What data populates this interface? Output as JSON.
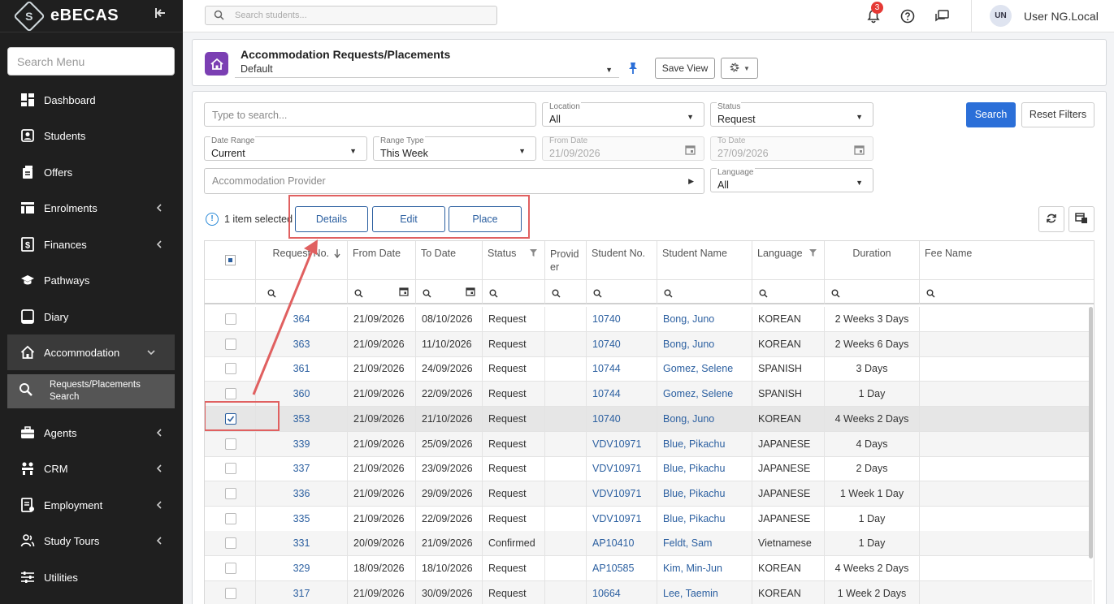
{
  "brand": {
    "name": "eBECAS",
    "logo_letter": "S"
  },
  "sidebar": {
    "search_placeholder": "Search Menu",
    "items": [
      {
        "label": "Dashboard",
        "icon": "dashboard-icon",
        "has_chevron": false
      },
      {
        "label": "Students",
        "icon": "student-card-icon",
        "has_chevron": false
      },
      {
        "label": "Offers",
        "icon": "offers-icon",
        "has_chevron": false
      },
      {
        "label": "Enrolments",
        "icon": "enrolments-icon",
        "has_chevron": true
      },
      {
        "label": "Finances",
        "icon": "dollar-icon",
        "has_chevron": true
      },
      {
        "label": "Pathways",
        "icon": "graduation-cap-icon",
        "has_chevron": false
      },
      {
        "label": "Diary",
        "icon": "diary-icon",
        "has_chevron": false
      },
      {
        "label": "Accommodation",
        "icon": "home-icon",
        "has_chevron": true,
        "expanded": true
      },
      {
        "label": "Agents",
        "icon": "briefcase-icon",
        "has_chevron": true
      },
      {
        "label": "CRM",
        "icon": "crm-icon",
        "has_chevron": true
      },
      {
        "label": "Employment",
        "icon": "employment-icon",
        "has_chevron": true
      },
      {
        "label": "Study Tours",
        "icon": "people-icon",
        "has_chevron": true
      },
      {
        "label": "Utilities",
        "icon": "sliders-icon",
        "has_chevron": false
      }
    ],
    "sub_item": {
      "line1": "Requests/Placements",
      "line2": "Search",
      "icon": "search-icon"
    }
  },
  "topbar": {
    "search_placeholder": "Search students...",
    "notification_count": "3",
    "user_initials": "UN",
    "user_name": "User NG.Local"
  },
  "header": {
    "title": "Accommodation Requests/Placements",
    "view": "Default",
    "save_view_label": "Save View"
  },
  "filters": {
    "search_placeholder": "Type to search...",
    "location": {
      "label": "Location",
      "value": "All"
    },
    "status": {
      "label": "Status",
      "value": "Request"
    },
    "date_range": {
      "label": "Date Range",
      "value": "Current"
    },
    "range_type": {
      "label": "Range Type",
      "value": "This Week"
    },
    "from_date": {
      "label": "From Date",
      "value": "21/09/2026"
    },
    "to_date": {
      "label": "To Date",
      "value": "27/09/2026"
    },
    "provider_placeholder": "Accommodation Provider",
    "language": {
      "label": "Language",
      "value": "All"
    },
    "search_label": "Search",
    "reset_label": "Reset Filters"
  },
  "selection": {
    "info": "1 item selected",
    "details_label": "Details",
    "edit_label": "Edit",
    "place_label": "Place"
  },
  "table": {
    "columns": [
      "Request No.",
      "From Date",
      "To Date",
      "Status",
      "Provid er",
      "Student No.",
      "Student Name",
      "Language",
      "Duration",
      "Fee Name"
    ],
    "rows": [
      {
        "req": "364",
        "from": "21/09/2026",
        "to": "08/10/2026",
        "status": "Request",
        "provider": "",
        "student_no": "10740",
        "name": "Bong, Juno",
        "lang": "KOREAN",
        "duration": "2 Weeks 3 Days",
        "fee": "",
        "checked": false
      },
      {
        "req": "363",
        "from": "21/09/2026",
        "to": "11/10/2026",
        "status": "Request",
        "provider": "",
        "student_no": "10740",
        "name": "Bong, Juno",
        "lang": "KOREAN",
        "duration": "2 Weeks 6 Days",
        "fee": "",
        "checked": false
      },
      {
        "req": "361",
        "from": "21/09/2026",
        "to": "24/09/2026",
        "status": "Request",
        "provider": "",
        "student_no": "10744",
        "name": "Gomez, Selene",
        "lang": "SPANISH",
        "duration": "3 Days",
        "fee": "",
        "checked": false
      },
      {
        "req": "360",
        "from": "21/09/2026",
        "to": "22/09/2026",
        "status": "Request",
        "provider": "",
        "student_no": "10744",
        "name": "Gomez, Selene",
        "lang": "SPANISH",
        "duration": "1 Day",
        "fee": "",
        "checked": false
      },
      {
        "req": "353",
        "from": "21/09/2026",
        "to": "21/10/2026",
        "status": "Request",
        "provider": "",
        "student_no": "10740",
        "name": "Bong, Juno",
        "lang": "KOREAN",
        "duration": "4 Weeks 2 Days",
        "fee": "",
        "checked": true
      },
      {
        "req": "339",
        "from": "21/09/2026",
        "to": "25/09/2026",
        "status": "Request",
        "provider": "",
        "student_no": "VDV10971",
        "name": "Blue, Pikachu",
        "lang": "JAPANESE",
        "duration": "4 Days",
        "fee": "",
        "checked": false
      },
      {
        "req": "337",
        "from": "21/09/2026",
        "to": "23/09/2026",
        "status": "Request",
        "provider": "",
        "student_no": "VDV10971",
        "name": "Blue, Pikachu",
        "lang": "JAPANESE",
        "duration": "2 Days",
        "fee": "",
        "checked": false
      },
      {
        "req": "336",
        "from": "21/09/2026",
        "to": "29/09/2026",
        "status": "Request",
        "provider": "",
        "student_no": "VDV10971",
        "name": "Blue, Pikachu",
        "lang": "JAPANESE",
        "duration": "1 Week 1 Day",
        "fee": "",
        "checked": false
      },
      {
        "req": "335",
        "from": "21/09/2026",
        "to": "22/09/2026",
        "status": "Request",
        "provider": "",
        "student_no": "VDV10971",
        "name": "Blue, Pikachu",
        "lang": "JAPANESE",
        "duration": "1 Day",
        "fee": "",
        "checked": false
      },
      {
        "req": "331",
        "from": "20/09/2026",
        "to": "21/09/2026",
        "status": "Confirmed",
        "provider": "",
        "student_no": "AP10410",
        "name": "Feldt, Sam",
        "lang": "Vietnamese",
        "duration": "1 Day",
        "fee": "",
        "checked": false
      },
      {
        "req": "329",
        "from": "18/09/2026",
        "to": "18/10/2026",
        "status": "Request",
        "provider": "",
        "student_no": "AP10585",
        "name": "Kim, Min-Jun",
        "lang": "KOREAN",
        "duration": "4 Weeks 2 Days",
        "fee": "",
        "checked": false
      },
      {
        "req": "317",
        "from": "21/09/2026",
        "to": "30/09/2026",
        "status": "Request",
        "provider": "",
        "student_no": "10664",
        "name": "Lee, Taemin",
        "lang": "KOREAN",
        "duration": "1 Week 2 Days",
        "fee": "",
        "checked": false
      }
    ]
  },
  "colors": {
    "accent": "#2b6fd8",
    "link": "#2b5fa0",
    "page_icon": "#7b3fb3",
    "highlight": "#e06060",
    "badge": "#e53935"
  }
}
